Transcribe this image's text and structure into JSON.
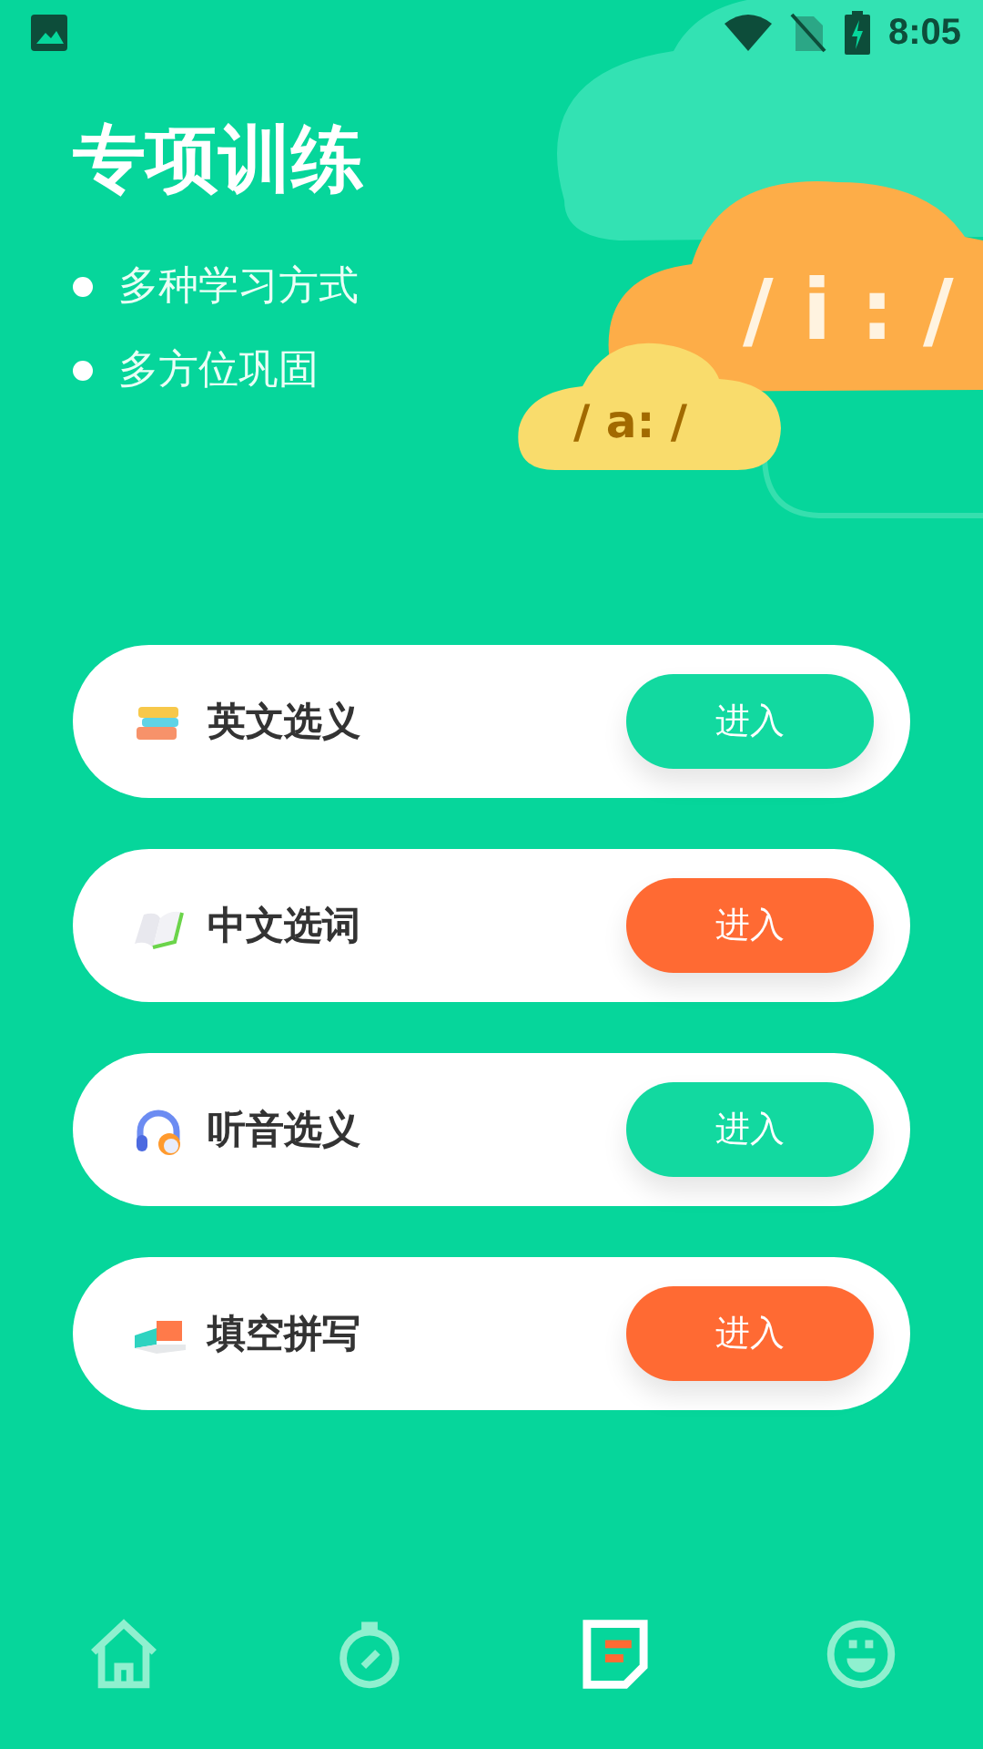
{
  "status_bar": {
    "time": "8:05"
  },
  "header": {
    "title": "专项训练",
    "bullets": [
      "多种学习方式",
      "多方位巩固"
    ],
    "cloud_large_text": "/ i : /",
    "cloud_small_text": "/ a: /"
  },
  "modes": [
    {
      "kind": "books",
      "label": "英文选义",
      "button": "进入",
      "color": "#12d9a0"
    },
    {
      "kind": "open-book",
      "label": "中文选词",
      "button": "进入",
      "color": "#ff6a33"
    },
    {
      "kind": "headphones",
      "label": "听音选义",
      "button": "进入",
      "color": "#12d9a0"
    },
    {
      "kind": "eraser",
      "label": "填空拼写",
      "button": "进入",
      "color": "#ff6a33"
    }
  ],
  "bottom_nav": [
    {
      "kind": "home",
      "selected": false
    },
    {
      "kind": "timer",
      "selected": false
    },
    {
      "kind": "note",
      "selected": true
    },
    {
      "kind": "smile",
      "selected": false
    }
  ]
}
